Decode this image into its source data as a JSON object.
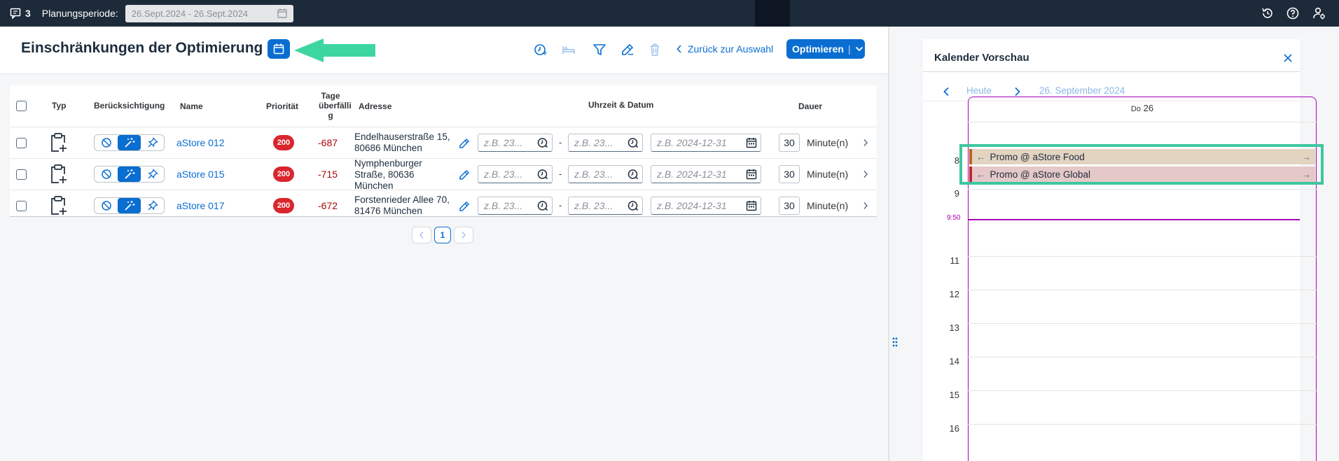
{
  "topbar": {
    "counter": "3",
    "period_label": "Planungsperiode:",
    "period_value": "26.Sept.2024 - 26.Sept.2024",
    "icons": [
      "history-icon",
      "help-icon",
      "user-settings-icon"
    ]
  },
  "header": {
    "title": "Einschränkungen der Optimierung",
    "back_label": "Zurück zur Auswahl",
    "optimize_label": "Optimieren",
    "toolbar_icons": [
      "time-priority-icon",
      "bed-icon",
      "filter-icon",
      "edit-sign-icon",
      "delete-icon"
    ]
  },
  "table": {
    "headers": {
      "typ": "Typ",
      "consider": "Berücksichtigung",
      "name": "Name",
      "prio": "Priorität",
      "overdue_l1": "Tage",
      "overdue_l2": "überfälli",
      "overdue_l3": "g",
      "address": "Adresse",
      "datetime": "Uhrzeit & Datum",
      "duration": "Dauer"
    },
    "time_placeholder": "z.B. 23...",
    "date_placeholder": "z.B. 2024-12-31",
    "range_separator": "-",
    "unit": "Minute(n)",
    "rows": [
      {
        "name": "aStore 012",
        "priority": "200",
        "overdue": "-687",
        "address": "Endelhauserstraße 15, 80686 München",
        "duration": "30"
      },
      {
        "name": "aStore 015",
        "priority": "200",
        "overdue": "-715",
        "address": "Nymphenburger Straße, 80636 München",
        "duration": "30"
      },
      {
        "name": "aStore 017",
        "priority": "200",
        "overdue": "-672",
        "address": "Forstenrieder Allee 70, 81476 München",
        "duration": "30"
      }
    ]
  },
  "pager": {
    "current": "1"
  },
  "calendar": {
    "title": "Kalender Vorschau",
    "today": "Heute",
    "date": "26. September 2024",
    "day_label": "Do",
    "day_num": "26",
    "now_time": "9:50",
    "hours": [
      "8",
      "9",
      "11",
      "12",
      "13",
      "14",
      "15",
      "16"
    ],
    "events": [
      {
        "label": "Promo @ aStore Food",
        "color": "#b5651d",
        "bg": "#e3d3c1"
      },
      {
        "label": "Promo @ aStore Global",
        "color": "#c0272d",
        "bg": "#e5c8c8"
      }
    ]
  },
  "colors": {
    "accent": "#0a6ed1",
    "now": "#a800b5",
    "highlight": "#3ec6a0"
  }
}
